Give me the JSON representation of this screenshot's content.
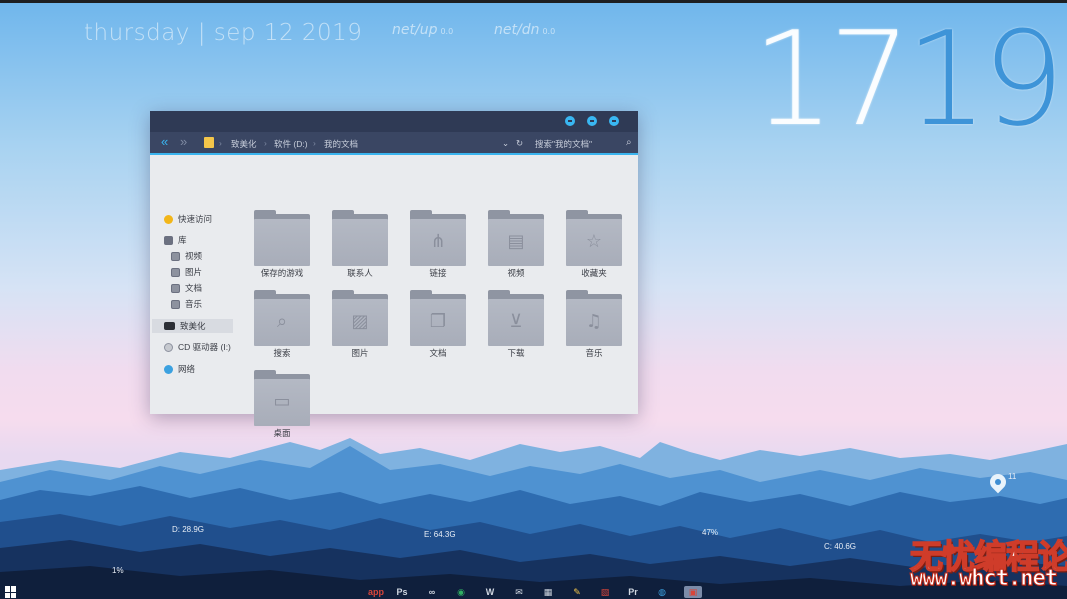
{
  "widgets": {
    "date": "thursday  |  sep 12 2019",
    "net_up": {
      "label": "net/up",
      "unit": "0.0"
    },
    "net_dn": {
      "label": "net/dn",
      "unit": "0.0"
    },
    "clock_a": "17",
    "clock_b": "19"
  },
  "explorer": {
    "breadcrumb": [
      "致美化",
      "软件 (D:)",
      "我的文档"
    ],
    "back_glyph": "«",
    "forward_glyph": "»",
    "separator": "›",
    "refresh_glyph": "↻",
    "dropdown_glyph": "⌄",
    "search_placeholder": "搜索\"我的文档\"",
    "search_glyph": "⌕",
    "sidebar": {
      "quick_access": "快速访问",
      "library": "库",
      "library_items": [
        "视频",
        "图片",
        "文档",
        "音乐"
      ],
      "this_pc": "致美化",
      "cd_drive": "CD 驱动器 (I:)",
      "network": "网络"
    },
    "items": [
      {
        "label": "保存的游戏",
        "icon": "folder-plain",
        "glyph": ""
      },
      {
        "label": "联系人",
        "icon": "folder-plain",
        "glyph": ""
      },
      {
        "label": "链接",
        "icon": "share-icon",
        "glyph": "⋔"
      },
      {
        "label": "视频",
        "icon": "film-icon",
        "glyph": "▤"
      },
      {
        "label": "收藏夹",
        "icon": "star-icon",
        "glyph": "☆"
      },
      {
        "label": "搜索",
        "icon": "search-icon",
        "glyph": "⌕"
      },
      {
        "label": "图片",
        "icon": "image-icon",
        "glyph": "▨"
      },
      {
        "label": "文档",
        "icon": "document-icon",
        "glyph": "❐"
      },
      {
        "label": "下载",
        "icon": "download-icon",
        "glyph": "⊻"
      },
      {
        "label": "音乐",
        "icon": "music-icon",
        "glyph": "♫"
      },
      {
        "label": "桌面",
        "icon": "desktop-icon",
        "glyph": "▭"
      }
    ]
  },
  "desktop_stats": {
    "disk_d": "D: 28.9G",
    "disk_e": "E: 64.3G",
    "disk_c": "C: 40.6G",
    "mem_pct": "47%",
    "cpu_pct": "1%",
    "weather_temp": "11"
  },
  "taskbar": {
    "icons": [
      "app",
      "Ps",
      "∞",
      "◉",
      "W",
      "✉",
      "▦",
      "✎",
      "▧",
      "Pr",
      "◍",
      "▣"
    ]
  },
  "watermark": {
    "line1": "无忧编程论坛",
    "line2": "www.whct.net"
  }
}
